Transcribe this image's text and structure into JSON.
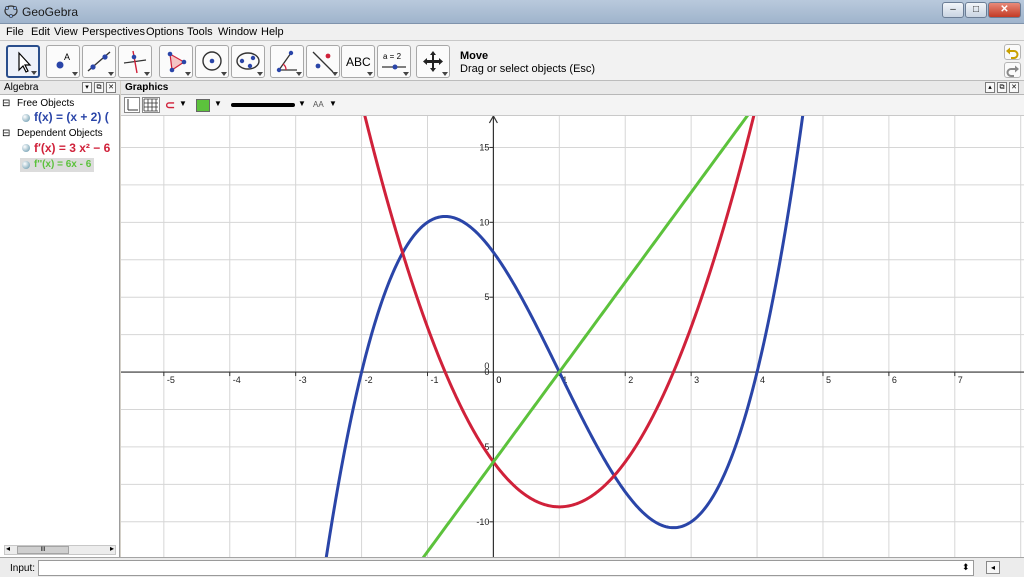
{
  "window": {
    "title": "GeoGebra"
  },
  "menu": [
    "File",
    "Edit",
    "View",
    "Perspectives",
    "Options",
    "Tools",
    "Window",
    "Help"
  ],
  "toolbar": {
    "tools": [
      "move",
      "point",
      "line-through-two-points",
      "perpendicular-line",
      "polygon",
      "circle-with-center",
      "conic-through-points",
      "angle",
      "reflect-about-line",
      "text",
      "slider",
      "move-graphics-view"
    ],
    "text_tool_label": "ABC",
    "slider_tool_label": "a = 2",
    "help_title": "Move",
    "help_text": "Drag or select objects (Esc)"
  },
  "algebra": {
    "title": "Algebra",
    "free_group": "Free Objects",
    "free_items": [
      {
        "text": "f(x) = (x + 2) (",
        "color": "#2a45a8"
      }
    ],
    "dependent_group": "Dependent Objects",
    "dependent_items": [
      {
        "text": "f′(x) = 3 x² − 6",
        "color": "#d0213a"
      },
      {
        "text": "f''(x) = 6x - 6",
        "color": "#5cc23c"
      }
    ],
    "scroll_thumb": "III"
  },
  "graphics": {
    "title": "Graphics",
    "style_bar_color": "#5cc23c",
    "label_style": "AA"
  },
  "chart_data": {
    "type": "line",
    "xlim": [
      -5.65,
      8.05
    ],
    "ylim": [
      -12.35,
      17.1
    ],
    "x_ticks": [
      -5,
      -4,
      -3,
      -2,
      -1,
      0,
      1,
      2,
      3,
      4,
      5,
      6,
      7
    ],
    "y_ticks": [
      -10,
      -5,
      0,
      5,
      10,
      15
    ],
    "grid": true,
    "series": [
      {
        "name": "f",
        "color": "#2a45a8",
        "coeffs": [
          1,
          -3,
          -6,
          8
        ]
      },
      {
        "name": "f'",
        "color": "#d0213a",
        "coeffs": [
          0,
          3,
          -6,
          -6
        ]
      },
      {
        "name": "f''",
        "color": "#5cc23c",
        "coeffs": [
          0,
          0,
          6,
          -6
        ]
      }
    ]
  },
  "input": {
    "label": "Input:",
    "value": ""
  }
}
